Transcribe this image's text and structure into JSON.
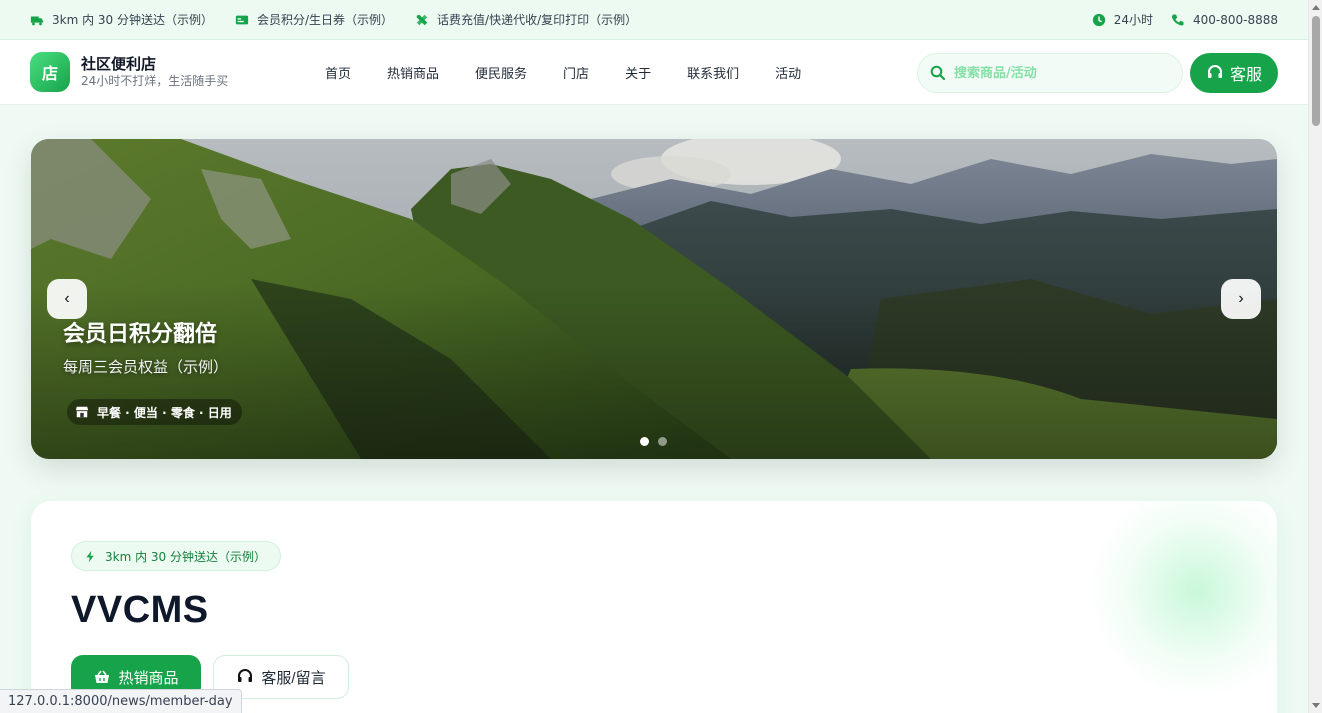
{
  "topbar": {
    "delivery": "3km 内 30 分钟送达（示例）",
    "membership": "会员积分/生日券（示例）",
    "services": "话费充值/快递代收/复印打印（示例）",
    "hours": "24小时",
    "phone": "400-800-8888"
  },
  "header": {
    "logo_char": "店",
    "brand_name": "社区便利店",
    "brand_sub": "24小时不打烊，生活随手买",
    "nav": [
      "首页",
      "热销商品",
      "便民服务",
      "门店",
      "关于",
      "联系我们",
      "活动"
    ],
    "search_placeholder": "搜索商品/活动",
    "cs_label": "客服"
  },
  "hero": {
    "title": "会员日积分翻倍",
    "subtitle": "每周三会员权益（示例）",
    "tag": "早餐 · 便当 · 零食 · 日用",
    "prev": "‹",
    "next": "›",
    "slide_count": 2,
    "active_slide": 1
  },
  "card": {
    "pill": "3km 内 30 分钟送达（示例）",
    "title": "VVCMS",
    "primary_button": "热销商品",
    "secondary_button": "客服/留言"
  },
  "statusbar": {
    "url": "127.0.0.1:8000/news/member-day"
  },
  "colors": {
    "accent": "#16a34a",
    "accent_light": "#ecfaf1",
    "page_bg": "#eefaf3"
  },
  "icons": {
    "delivery": "truck-icon",
    "membership": "card-icon",
    "services": "tools-icon",
    "hours": "clock-icon",
    "phone": "phone-icon",
    "search": "search-icon",
    "cs": "headset-icon",
    "tag": "store-icon",
    "pill": "bolt-icon",
    "primary_button": "basket-icon",
    "secondary_button": "headset-icon"
  }
}
